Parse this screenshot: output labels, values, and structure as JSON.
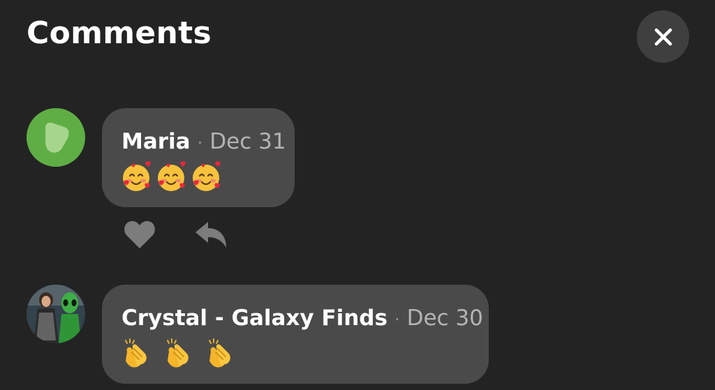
{
  "header": {
    "title": "Comments",
    "close_icon": "close-icon"
  },
  "comments": [
    {
      "author": "Maria",
      "separator": "·",
      "date": "Dec 31",
      "avatar": "green-blob-avatar",
      "emojis": [
        "smiling-face-with-hearts",
        "smiling-face-with-hearts",
        "smiling-face-with-hearts"
      ],
      "actions": [
        "heart-icon",
        "reply-icon"
      ]
    },
    {
      "author": "Crystal - Galaxy Finds",
      "separator": "·",
      "date": "Dec 30",
      "avatar": "photo-avatar",
      "emojis": [
        "clapping-hands",
        "clapping-hands",
        "clapping-hands"
      ]
    }
  ],
  "colors": {
    "background": "#232323",
    "bubble": "#4a4a4a",
    "close_button": "#3f3f3f",
    "maria_avatar": "#5fae45",
    "action_icon": "#7c7c7c",
    "date_text": "#b4b4b4"
  }
}
